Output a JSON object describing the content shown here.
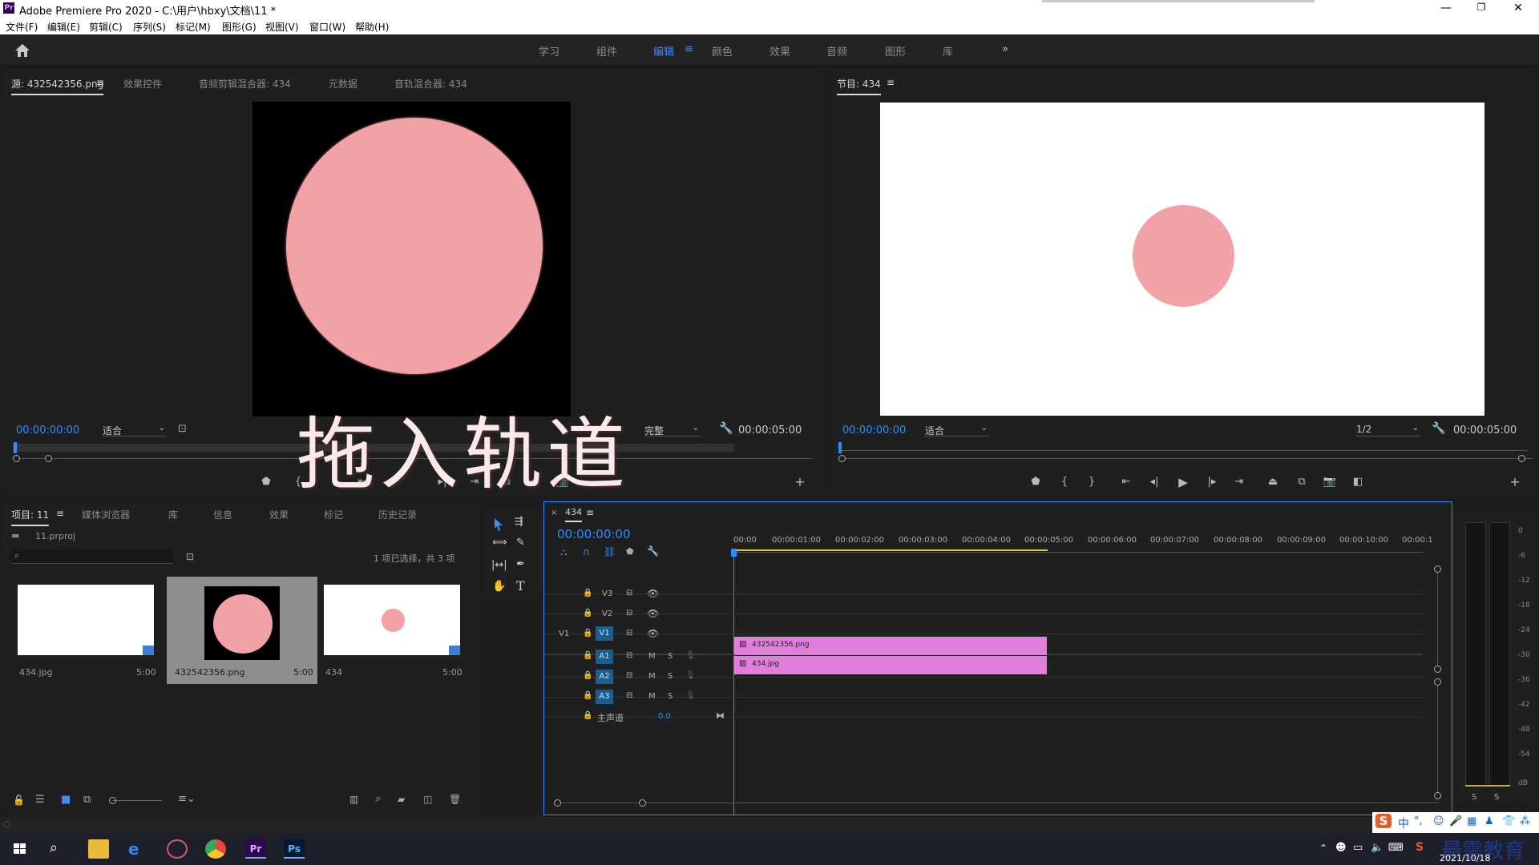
{
  "window": {
    "title": "Adobe Premiere Pro 2020 - C:\\用户\\hbxy\\文档\\11 *",
    "app_icon": "Pr"
  },
  "menu": [
    "文件(F)",
    "编辑(E)",
    "剪辑(C)",
    "序列(S)",
    "标记(M)",
    "图形(G)",
    "视图(V)",
    "窗口(W)",
    "帮助(H)"
  ],
  "workspaces": [
    "学习",
    "组件",
    "编辑",
    "颜色",
    "效果",
    "音频",
    "图形",
    "库"
  ],
  "workspace_more": "»",
  "source_panel": {
    "tabs": [
      "源: 432542356.png",
      "效果控件",
      "音频剪辑混合器: 434",
      "元数据",
      "音轨混合器: 434"
    ],
    "timecode": "00:00:00:00",
    "fit": "适合",
    "quality": "完整",
    "duration": "00:00:05:00"
  },
  "program_panel": {
    "tab": "节目: 434",
    "timecode": "00:00:00:00",
    "fit": "适合",
    "quality": "1/2",
    "duration": "00:00:05:00"
  },
  "overlay_caption": "拖入轨道",
  "project_panel": {
    "tabs": [
      "项目: 11",
      "媒体浏览器",
      "库",
      "信息",
      "效果",
      "标记",
      "历史记录"
    ],
    "file": "11.prproj",
    "selection_info": "1 项已选择，共 3 项",
    "items": [
      {
        "name": "434.jpg",
        "duration": "5:00"
      },
      {
        "name": "432542356.png",
        "duration": "5:00"
      },
      {
        "name": "434",
        "duration": "5:00"
      }
    ]
  },
  "timeline": {
    "tab": "434",
    "timecode": "00:00:00:00",
    "ruler": [
      "00:00",
      "00:00:01:00",
      "00:00:02:00",
      "00:00:03:00",
      "00:00:04:00",
      "00:00:05:00",
      "00:00:06:00",
      "00:00:07:00",
      "00:00:08:00",
      "00:00:09:00",
      "00:00:10:00",
      "00:00:1"
    ],
    "video_tracks": [
      "V3",
      "V2",
      "V1"
    ],
    "source_patch": "V1",
    "audio_tracks": [
      "A1",
      "A2",
      "A3"
    ],
    "master": {
      "label": "主声道",
      "value": "0.0"
    },
    "clips": [
      {
        "name": "432542356.png",
        "track": "V2"
      },
      {
        "name": "434.jpg",
        "track": "V1"
      }
    ],
    "audio_buttons": {
      "mute": "M",
      "solo": "S"
    }
  },
  "audio_meter": {
    "scale": [
      "0",
      "-6",
      "-12",
      "-18",
      "-24",
      "-30",
      "-36",
      "-42",
      "-48",
      "-54",
      "dB"
    ],
    "buttons": [
      "S",
      "S"
    ]
  },
  "taskbar": {
    "ime": "中",
    "watermark": "最需教育",
    "date": "2021/10/18"
  },
  "colors": {
    "accent": "#2f8bff",
    "clip": "#e07fdb",
    "circle": "#f2a1a5",
    "target": "#1b5e8f"
  }
}
